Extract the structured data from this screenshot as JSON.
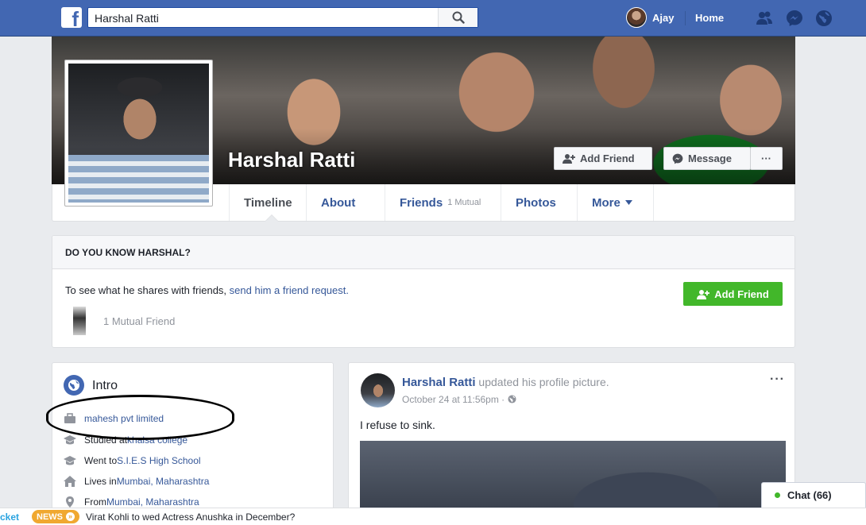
{
  "topbar": {
    "logo": "f",
    "search_value": "Harshal Ratti",
    "user_name": "Ajay",
    "home_label": "Home",
    "icons": [
      "friends-icon",
      "messenger-icon",
      "notifications-globe-icon"
    ]
  },
  "profile": {
    "name": "Harshal Ratti",
    "add_friend_label": "Add Friend",
    "message_label": "Message",
    "more_dots": "···"
  },
  "nav": {
    "tabs": [
      {
        "label": "Timeline",
        "sub": ""
      },
      {
        "label": "About",
        "sub": ""
      },
      {
        "label": "Friends",
        "sub": "1 Mutual"
      },
      {
        "label": "Photos",
        "sub": ""
      },
      {
        "label": "More",
        "sub": ""
      }
    ]
  },
  "know_card": {
    "heading": "DO YOU KNOW HARSHAL?",
    "text": "To see what he shares with friends, ",
    "link": "send him a friend request.",
    "button_label": "Add Friend",
    "mutual": "1 Mutual Friend"
  },
  "intro": {
    "title": "Intro",
    "items": [
      {
        "prefix": "",
        "link": "mahesh pvt limited",
        "icon": "briefcase-icon"
      },
      {
        "prefix": "Studied at ",
        "link": "khalsa college",
        "icon": "education-icon"
      },
      {
        "prefix": "Went to ",
        "link": "S.I.E.S High School",
        "icon": "graduation-cap-icon"
      },
      {
        "prefix": "Lives in ",
        "link": "Mumbai, Maharashtra",
        "icon": "home-icon"
      },
      {
        "prefix": "From ",
        "link": "Mumbai, Maharashtra",
        "icon": "location-pin-icon"
      }
    ]
  },
  "post": {
    "author": "Harshal Ratti",
    "action": " updated his profile picture.",
    "time": "October 24 at 11:56pm · ",
    "menu": "···",
    "text": "I refuse to sink."
  },
  "chat": {
    "label": "Chat (66)"
  },
  "ticker": {
    "left_text": "cket",
    "badge": "NEWS",
    "headline": "Virat Kohli to wed Actress Anushka in December?"
  },
  "colors": {
    "topbar": "#4267b2",
    "link": "#365899",
    "green": "#42b72a"
  }
}
